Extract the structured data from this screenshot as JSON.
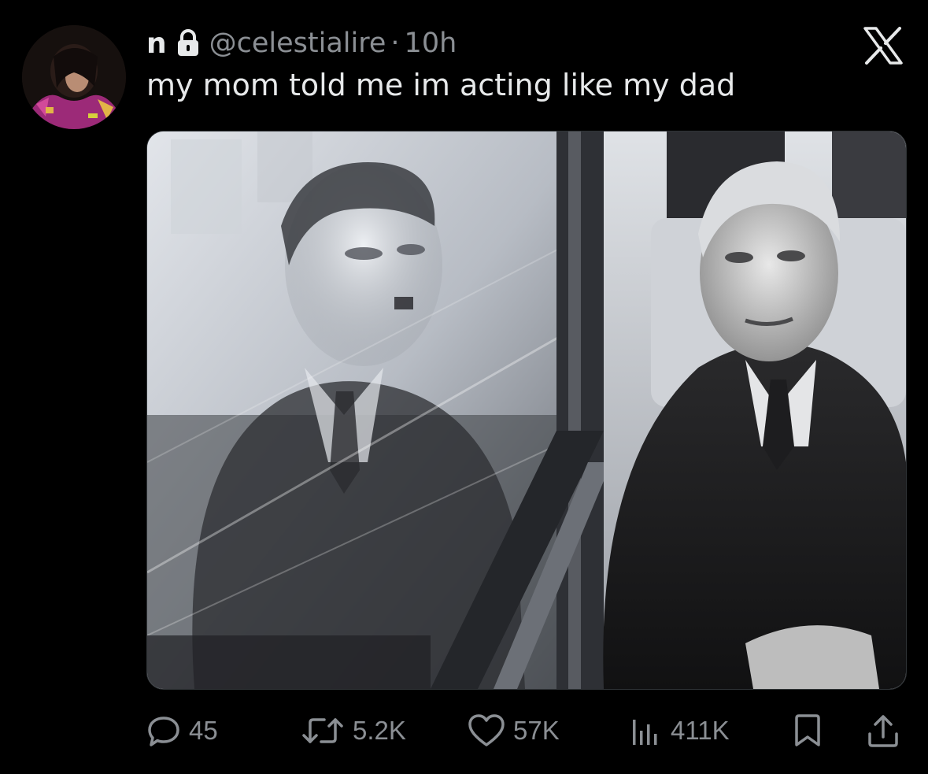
{
  "author": {
    "display_name": "n",
    "handle": "@celestialire",
    "separator": "·",
    "time": "10h",
    "avatar_icon": "avatar-image",
    "lock_icon": "lock-icon"
  },
  "platform_logo": "x-logo-icon",
  "tweet": {
    "text": "my mom told me im acting like my dad"
  },
  "media": {
    "type": "photo",
    "tone": "black-and-white"
  },
  "actions": {
    "replies": {
      "icon": "reply-icon",
      "count": "45"
    },
    "reposts": {
      "icon": "repost-icon",
      "count": "5.2K"
    },
    "likes": {
      "icon": "heart-icon",
      "count": "57K"
    },
    "views": {
      "icon": "views-icon",
      "count": "411K"
    },
    "bookmark": {
      "icon": "bookmark-icon"
    },
    "share": {
      "icon": "share-icon"
    }
  },
  "colors": {
    "background": "#000000",
    "text_primary": "#e7e9ea",
    "text_secondary": "#8b8f94"
  }
}
